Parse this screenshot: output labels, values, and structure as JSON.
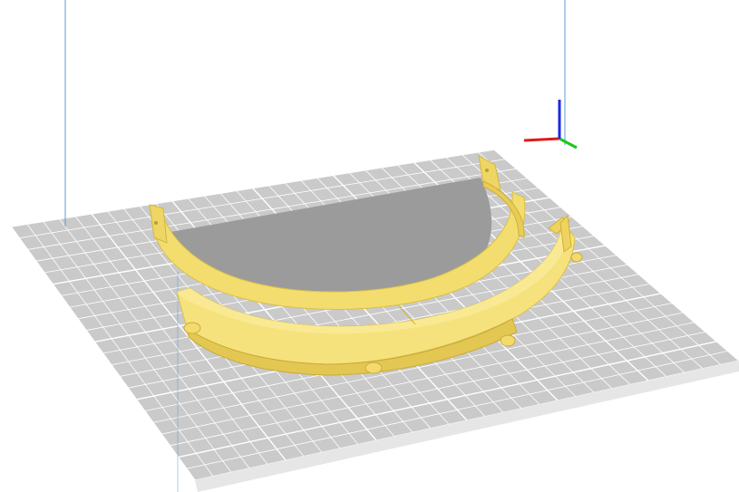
{
  "viewport": {
    "view": "3d-perspective",
    "background": "#ffffff"
  },
  "build_plate": {
    "grid": true,
    "plate_color": "#c8c8c8",
    "grid_color": "#ffffff",
    "plate_edge_color": "#e3e3e3"
  },
  "build_volume": {
    "edge_color": "#5b9bd5"
  },
  "axis_gizmo": {
    "x_color": "#e01919",
    "y_color": "#19c819",
    "z_color": "#1e28e6"
  },
  "model": {
    "shape": "curved-visor-frame",
    "color": "#f5e27a",
    "shadow_color": "#9b9b9b"
  }
}
